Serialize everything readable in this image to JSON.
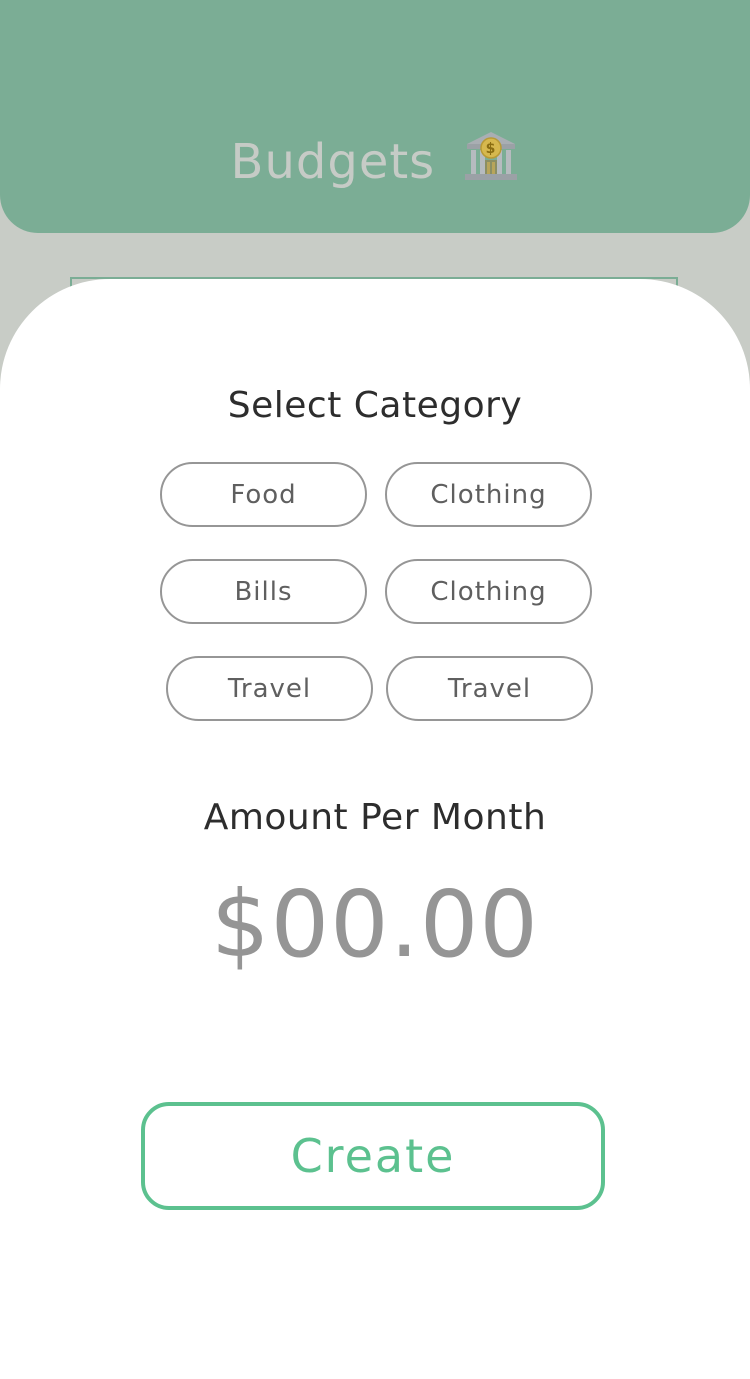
{
  "header": {
    "title": "Budgets",
    "icon": "bank-icon"
  },
  "form": {
    "category_label": "Select Category",
    "categories": [
      "Food",
      "Clothing",
      "Bills",
      "Clothing",
      "Travel",
      "Travel"
    ],
    "amount_label": "Amount Per Month",
    "amount_value": "$00.00",
    "create_label": "Create"
  },
  "colors": {
    "header_bg": "#7bad95",
    "backdrop": "#c8ccc6",
    "accent": "#5cc18f",
    "chip_border": "#969696"
  }
}
